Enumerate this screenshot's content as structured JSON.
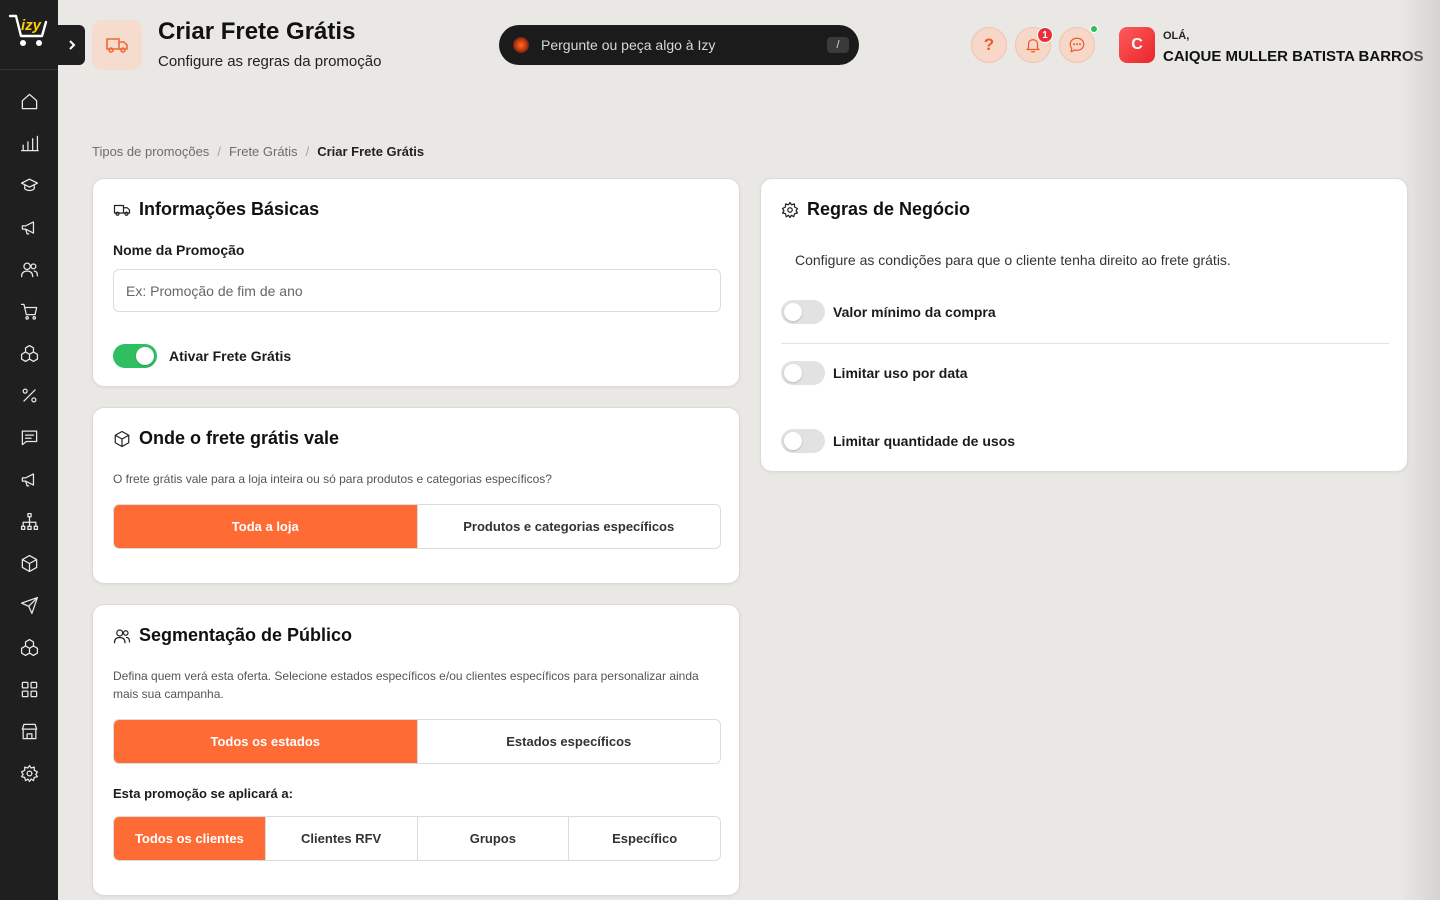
{
  "app": {
    "logo_text": "izy"
  },
  "header": {
    "title": "Criar Frete Grátis",
    "subtitle": "Configure as regras da promoção",
    "ask_placeholder": "Pergunte ou peça algo à Izy",
    "ask_shortcut": "/",
    "help_label": "?",
    "notifications_count": "1",
    "user": {
      "greeting": "OLÁ,",
      "name": "CAIQUE MULLER BATISTA BARROS",
      "initial": "C"
    }
  },
  "sidebar": {
    "items": [
      {
        "icon": "home-icon"
      },
      {
        "icon": "bar-chart-icon"
      },
      {
        "icon": "graduation-cap-icon"
      },
      {
        "icon": "megaphone-icon"
      },
      {
        "icon": "users-icon"
      },
      {
        "icon": "shopping-cart-icon"
      },
      {
        "icon": "boxes-icon"
      },
      {
        "icon": "percent-icon"
      },
      {
        "icon": "message-square-icon"
      },
      {
        "icon": "megaphone-icon"
      },
      {
        "icon": "network-icon"
      },
      {
        "icon": "package-icon"
      },
      {
        "icon": "send-icon"
      },
      {
        "icon": "boxes-icon"
      },
      {
        "icon": "grid-icon"
      },
      {
        "icon": "store-icon"
      },
      {
        "icon": "settings-icon"
      }
    ]
  },
  "breadcrumb": {
    "items": [
      "Tipos de promoções",
      "Frete Grátis"
    ],
    "current": "Criar Frete Grátis",
    "separator": "/"
  },
  "basic_info": {
    "title": "Informações Básicas",
    "name_label": "Nome da Promoção",
    "name_placeholder": "Ex: Promoção de fim de ano",
    "name_value": "",
    "toggle_label": "Ativar Frete Grátis",
    "toggle_on": true
  },
  "scope": {
    "title": "Onde o frete grátis vale",
    "description": "O frete grátis vale para a loja inteira ou só para produtos e categorias específicos?",
    "options": [
      "Toda a loja",
      "Produtos e categorias específicos"
    ],
    "selected": "Toda a loja"
  },
  "audience": {
    "title": "Segmentação de Público",
    "description": "Defina quem verá esta oferta. Selecione estados específicos e/ou clientes específicos para personalizar ainda mais sua campanha.",
    "state_options": [
      "Todos os estados",
      "Estados específicos"
    ],
    "state_selected": "Todos os estados",
    "applies_label": "Esta promoção se aplicará a:",
    "client_options": [
      "Todos os clientes",
      "Clientes RFV",
      "Grupos",
      "Específico"
    ],
    "client_selected": "Todos os clientes"
  },
  "business_rules": {
    "title": "Regras de Negócio",
    "description": "Configure as condições para que o cliente tenha direito ao frete grátis.",
    "rules": [
      {
        "label": "Valor mínimo da compra",
        "on": false
      },
      {
        "label": "Limitar uso por data",
        "on": false
      },
      {
        "label": "Limitar quantidade de usos",
        "on": false
      }
    ]
  },
  "colors": {
    "accent": "#ff6b35",
    "toggle_on": "#2fbf63",
    "sidebar_bg": "#1f1f1f",
    "page_bg": "#eae8e4"
  }
}
